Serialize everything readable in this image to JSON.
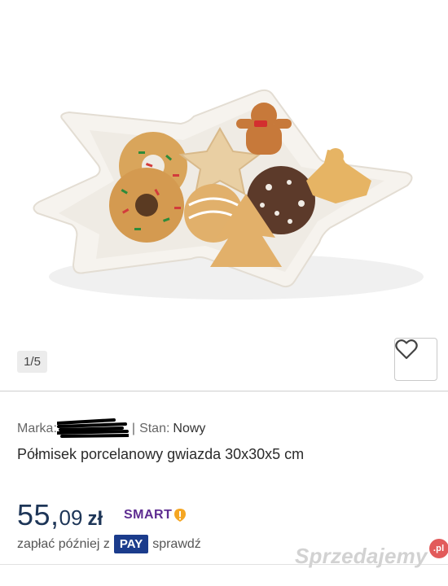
{
  "gallery": {
    "counter": "1/5"
  },
  "listing": {
    "brand_label": "Marka:",
    "separator": "|",
    "condition_label": "Stan:",
    "condition_value": "Nowy",
    "title": "Półmisek porcelanowy gwiazda 30x30x5 cm"
  },
  "price": {
    "main": "55,",
    "decimals": "09",
    "currency": "zł"
  },
  "smart": {
    "label": "SMART",
    "icon": "alert-icon",
    "color": "#5e2d91"
  },
  "payment": {
    "before": "zapłać później z",
    "badge": "PAY",
    "after": "sprawdź",
    "badge_color": "#1b3c8c"
  },
  "watermark": {
    "text": "Sprzedajemy",
    "badge": ".pl"
  },
  "icons": {
    "favorite": "heart-icon"
  }
}
